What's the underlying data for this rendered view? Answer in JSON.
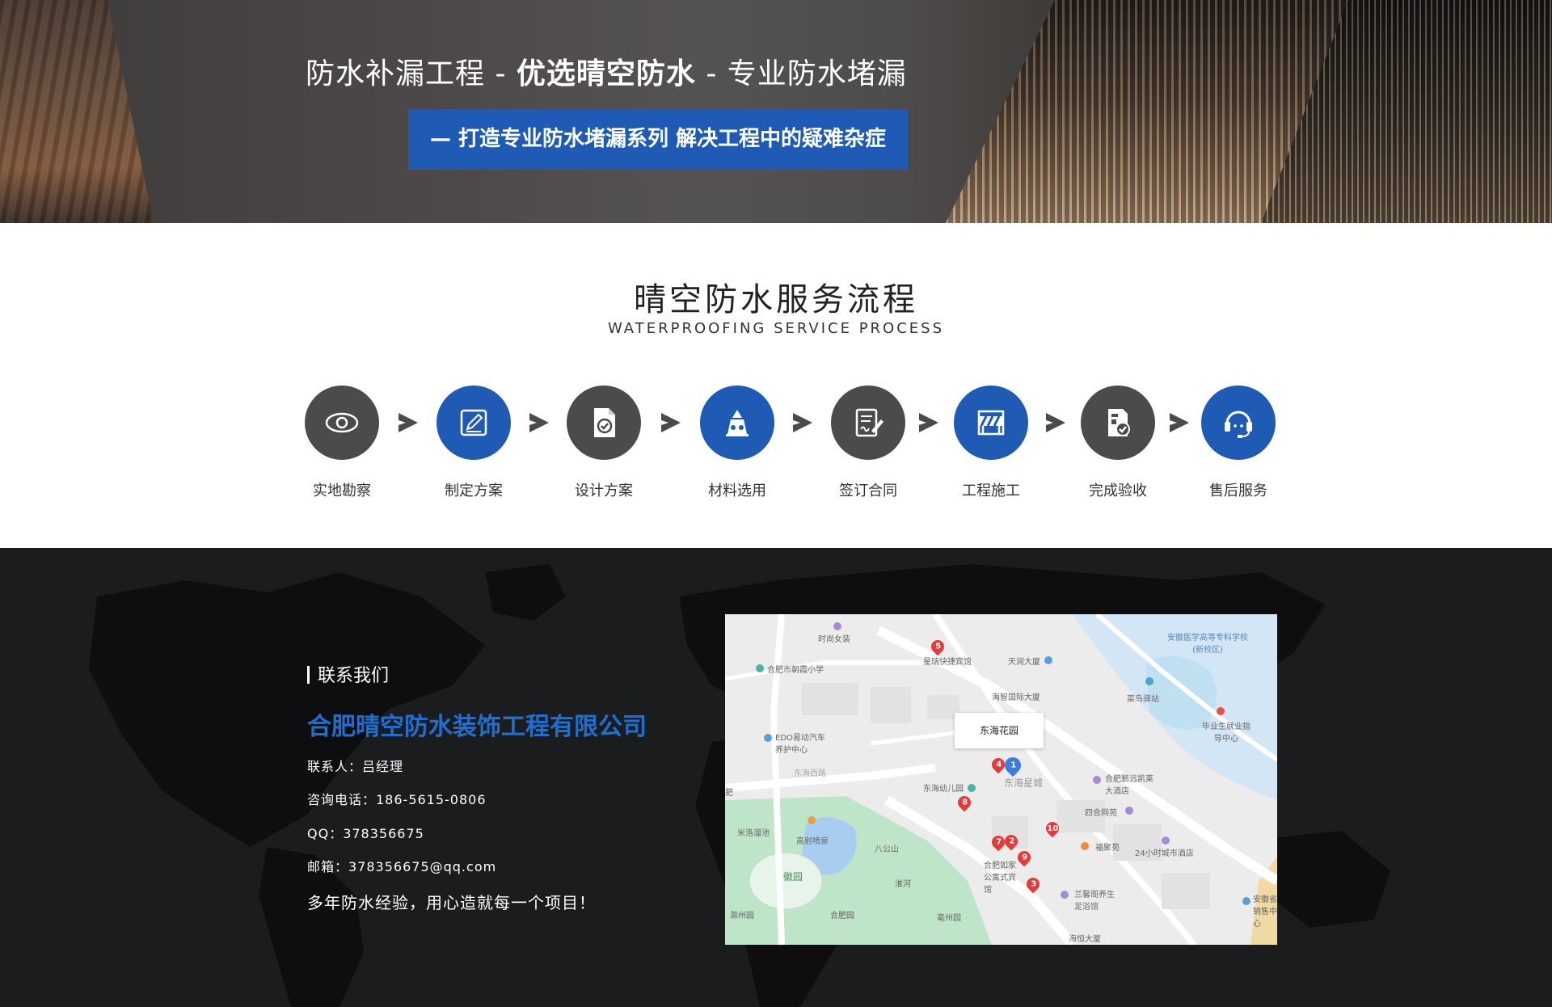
{
  "hero": {
    "headline_part1": "防水补漏工程 - ",
    "headline_bold": "优选晴空防水",
    "headline_part2": " - 专业防水堵漏",
    "banner": "— 打造专业防水堵漏系列 解决工程中的疑难杂症"
  },
  "process": {
    "title": "晴空防水服务流程",
    "subtitle": "WATERPROOFING SERVICE PROCESS",
    "steps": [
      {
        "label": "实地勘察",
        "icon": "eye-icon",
        "color": "gray"
      },
      {
        "label": "制定方案",
        "icon": "edit-icon",
        "color": "blue"
      },
      {
        "label": "设计方案",
        "icon": "document-check-icon",
        "color": "gray"
      },
      {
        "label": "材料选用",
        "icon": "material-icon",
        "color": "blue"
      },
      {
        "label": "签订合同",
        "icon": "contract-sign-icon",
        "color": "gray"
      },
      {
        "label": "工程施工",
        "icon": "construction-barrier-icon",
        "color": "blue"
      },
      {
        "label": "完成验收",
        "icon": "acceptance-check-icon",
        "color": "gray"
      },
      {
        "label": "售后服务",
        "icon": "headset-icon",
        "color": "blue"
      }
    ]
  },
  "contact": {
    "heading": "联系我们",
    "company": "合肥晴空防水装饰工程有限公司",
    "contact_person": "联系人：吕经理",
    "phone": "咨询电话：186-5615-0806",
    "qq": "QQ：378356675",
    "email": "邮箱：378356675@qq.com",
    "slogan": "多年防水经验，用心造就每一个项目！"
  },
  "map": {
    "tooltip": "东海花园",
    "labels": {
      "l1": "时尚女装",
      "l2": "星瑞快捷宾馆",
      "l3": "天润大厦",
      "l4": "安徽医学高等专科学校(新校区)",
      "l5": "合肥市朝霞小学",
      "l6": "海智国际大厦",
      "l7": "菜鸟驿站",
      "l8": "EDO易动汽车养护中心",
      "l9": "毕业生就业指导中心",
      "l10": "东海幼儿园",
      "l11": "东海星城",
      "l12": "合肥鹏远凯莱大酒店",
      "l13": "四合网苑",
      "l14": "米洛溜池",
      "l15": "高射喷泉",
      "l16": "八公山",
      "l17": "福聚苑",
      "l18": "24小时城市酒店",
      "l19": "合肥如家公寓式宾馆",
      "l20": "徽园",
      "l21": "滁州园",
      "l22": "淮河",
      "l23": "合肥园",
      "l24": "亳州园",
      "l25": "兰馨阁养生足浴馆",
      "l26": "海恒大厦",
      "l27": "安徽省销售中心",
      "l28": "东海西路",
      "l29": "肥"
    },
    "pins": [
      "1",
      "2",
      "3",
      "4",
      "5",
      "7",
      "8",
      "9",
      "10"
    ]
  },
  "colors": {
    "accent_blue": "#1f5bb5",
    "icon_gray": "#4b4b4b",
    "company_blue": "#1f6fd0",
    "footer_bg": "#1b1c1e"
  }
}
